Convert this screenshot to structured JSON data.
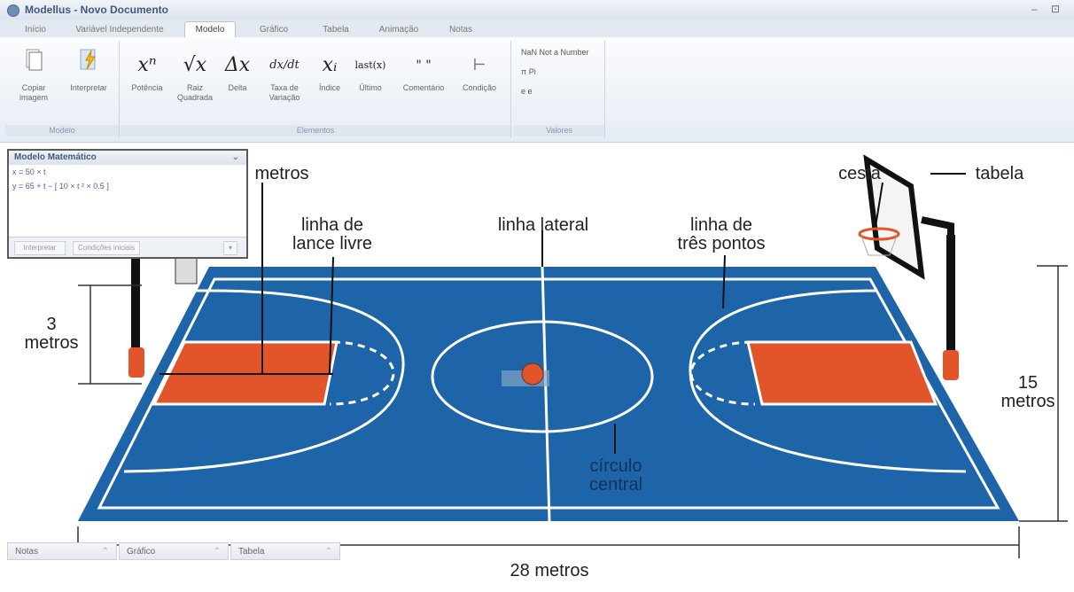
{
  "window": {
    "title": "Modellus - Novo Documento",
    "controls": "– ⊡"
  },
  "tabs": [
    "Início",
    "Variável Independente",
    "Modelo",
    "Gráfico",
    "Tabela",
    "Animação",
    "Notas"
  ],
  "ribbon": {
    "modelo_group": {
      "label": "Modelo",
      "copy_label": "Copiar imagem",
      "interpret_label": "Interpretar"
    },
    "elementos_group": {
      "label": "Elementos",
      "items": [
        {
          "symbol": "xⁿ",
          "label": "Potência"
        },
        {
          "symbol": "√x",
          "label": "Raiz Quadrada"
        },
        {
          "symbol": "Δx",
          "label": "Delta"
        },
        {
          "symbol": "dx/dt",
          "label": "Taxa de Variação"
        },
        {
          "symbol": "xᵢ",
          "label": "Índice"
        },
        {
          "symbol": "last(x)",
          "label": "Último"
        },
        {
          "symbol": "\" \"",
          "label": "Comentário"
        },
        {
          "symbol": "⊢",
          "label": "Condição"
        }
      ]
    },
    "valores_group": {
      "label": "Valores",
      "items": [
        "NaN Not a Number",
        "π Pi",
        "e e"
      ]
    }
  },
  "model_panel": {
    "title": "Modelo Matemático",
    "eq1": "x = 50 × t",
    "eq2": "y = 65 + t − [ 10 × t ² × 0.5 ]",
    "btn_interpret": "Interpretar",
    "btn_initial": "Condições iniciais"
  },
  "bottom_tabs": [
    "Notas",
    "Gráfico",
    "Tabela"
  ],
  "court_labels": {
    "metros_top": "metros",
    "lance_livre": "linha de\nlance livre",
    "linha_lateral": "linha lateral",
    "tres_pontos": "linha de\ntrês pontos",
    "cesta": "cesta",
    "tabela": "tabela",
    "tres_metros": "3\nmetros",
    "quinze_metros": "15\nmetros",
    "circulo_central": "círculo\ncentral",
    "vinte_oito_metros": "28 metros"
  },
  "colors": {
    "court_blue": "#1e64a8",
    "key_orange": "#e2542a",
    "line_white": "#ffffff"
  }
}
